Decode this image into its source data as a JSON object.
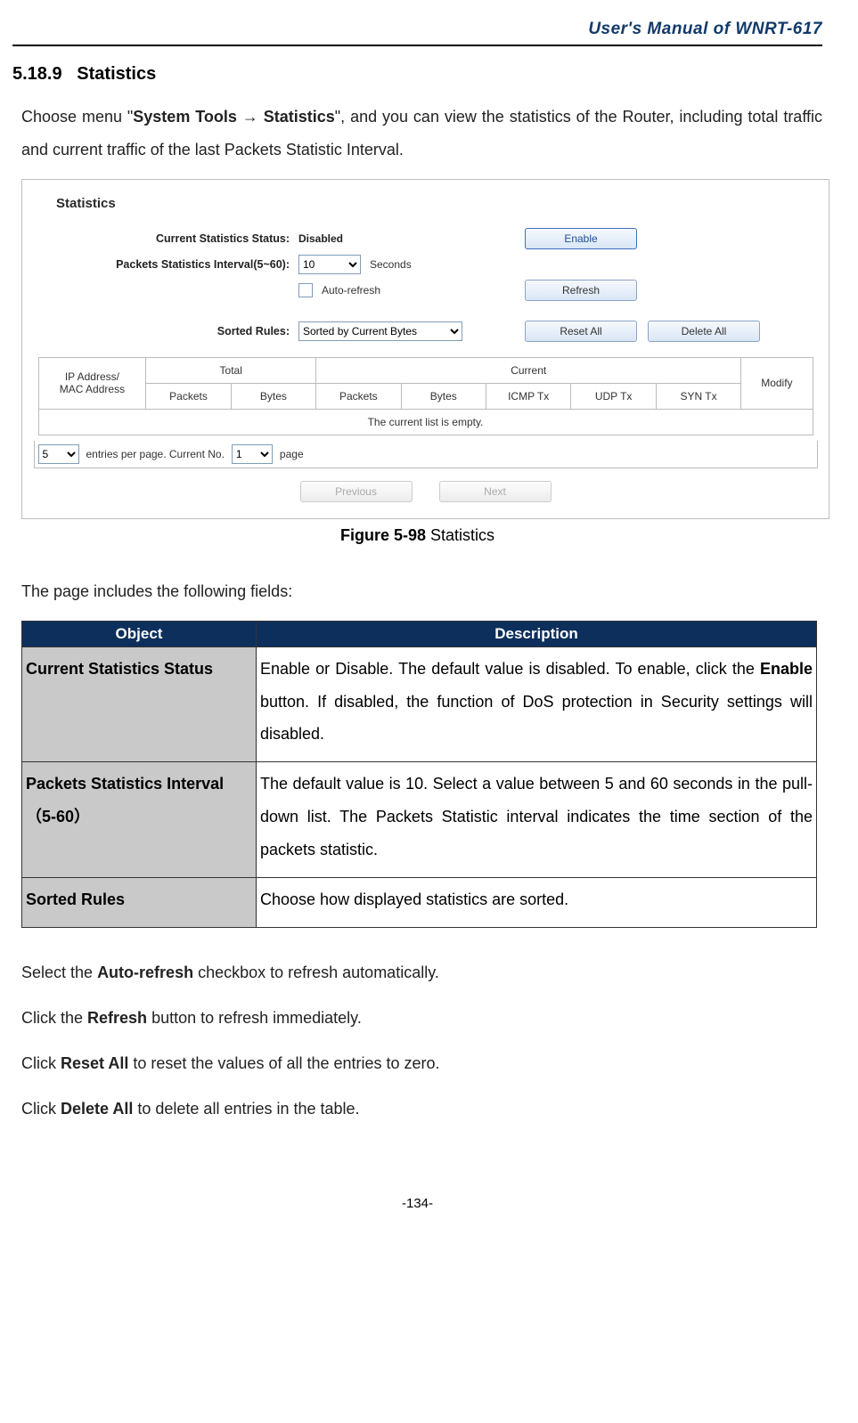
{
  "header": {
    "title": "User's Manual of WNRT-617"
  },
  "section": {
    "number": "5.18.9",
    "title": "Statistics",
    "intro_pre": "Choose menu \"",
    "intro_bold1": "System Tools ",
    "intro_arrow": "→ ",
    "intro_bold2": "Statistics",
    "intro_post": "\", and you can view the statistics of the Router, including total traffic and current traffic of the last Packets Statistic Interval."
  },
  "router": {
    "title": "Statistics",
    "labels": {
      "current_status": "Current Statistics Status:",
      "interval": "Packets Statistics Interval(5~60):",
      "auto_refresh": "Auto-refresh",
      "sorted_rules": "Sorted Rules:",
      "seconds": "Seconds"
    },
    "values": {
      "status": "Disabled",
      "interval": "10",
      "sort": "Sorted by Current Bytes"
    },
    "buttons": {
      "enable": "Enable",
      "refresh": "Refresh",
      "reset_all": "Reset All",
      "delete_all": "Delete All",
      "previous": "Previous",
      "next": "Next"
    },
    "table": {
      "ip_mac": "IP Address/\nMAC Address",
      "total": "Total",
      "current": "Current",
      "modify": "Modify",
      "packets": "Packets",
      "bytes": "Bytes",
      "icmp": "ICMP Tx",
      "udp": "UDP Tx",
      "syn": "SYN Tx",
      "empty": "The current list is empty."
    },
    "pager": {
      "entries_value": "5",
      "entries_label": "entries per page.   Current No.",
      "page_value": "1",
      "page_label": "page"
    }
  },
  "caption": {
    "bold": "Figure 5-98",
    "rest": "    Statistics"
  },
  "includes_line": "The page includes the following fields:",
  "desc_table": {
    "head_obj": "Object",
    "head_desc": "Description",
    "rows": [
      {
        "obj": "Current Statistics Status",
        "desc_pre": "Enable or Disable. The default value is disabled. To enable, click the ",
        "desc_bold": "Enable",
        "desc_post": " button. If disabled, the function of DoS protection in Security settings will disabled."
      },
      {
        "obj": "Packets Statistics Interval（5-60）",
        "desc_pre": "The default value is 10. Select a value between 5 and 60 seconds in the pull-down list. The Packets Statistic interval indicates the time section of the packets statistic.",
        "desc_bold": "",
        "desc_post": ""
      },
      {
        "obj": "Sorted Rules",
        "desc_pre": "Choose how displayed statistics are sorted.",
        "desc_bold": "",
        "desc_post": ""
      }
    ]
  },
  "notes": [
    {
      "pre": "Select the ",
      "bold": "Auto-refresh",
      "post": " checkbox to refresh automatically."
    },
    {
      "pre": "Click the ",
      "bold": "Refresh",
      "post": " button to refresh immediately."
    },
    {
      "pre": "Click ",
      "bold": "Reset All",
      "post": " to reset the values of all the entries to zero."
    },
    {
      "pre": "Click ",
      "bold": "Delete All",
      "post": " to delete all entries in the table."
    }
  ],
  "page_number": "-134-"
}
